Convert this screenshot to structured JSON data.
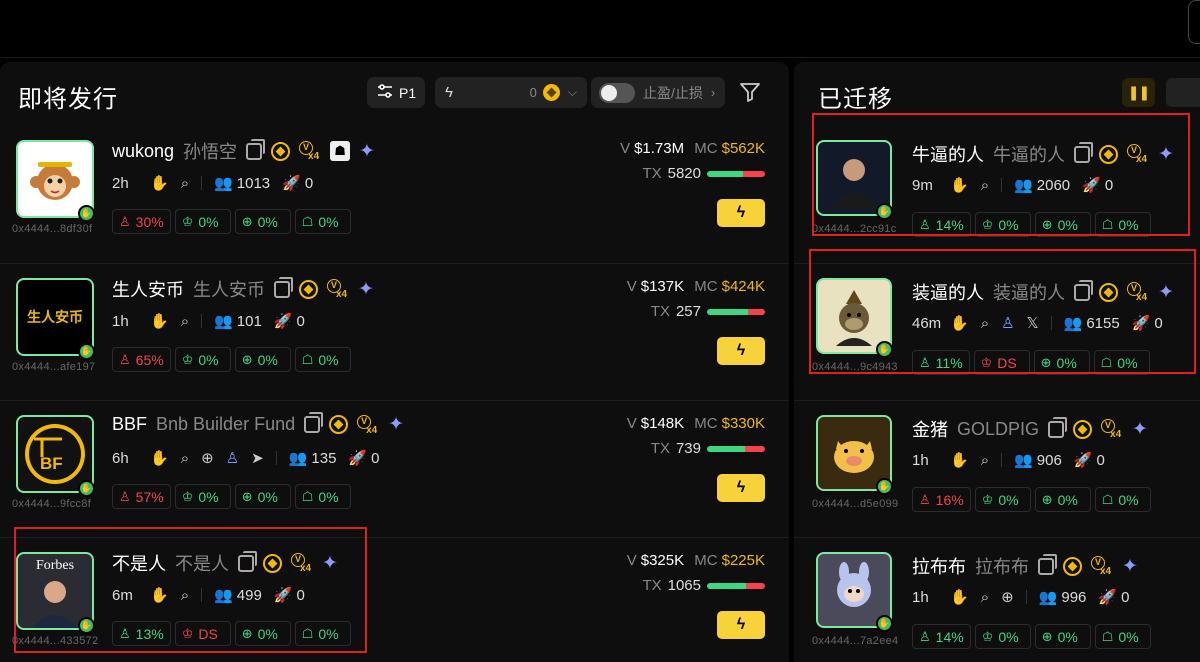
{
  "left_panel": {
    "title": "即将发行",
    "p1_label": "P1",
    "quick_buy_value": "0",
    "tp_sl_label": "止盈/止损",
    "rows": [
      {
        "symbol": "wukong",
        "name": "孙悟空",
        "age": "2h",
        "holders": "1013",
        "count": "0",
        "addr": "0x4444...8df30f",
        "stats": [
          "30%",
          "0%",
          "0%",
          "0%"
        ],
        "volume": "$1.73M",
        "mc": "$562K",
        "tx": "5820",
        "avatar_label": "🐵"
      },
      {
        "symbol": "生人安币",
        "name": "生人安币",
        "age": "1h",
        "holders": "101",
        "count": "0",
        "addr": "0x4444...afe197",
        "stats": [
          "65%",
          "0%",
          "0%",
          "0%"
        ],
        "volume": "$137K",
        "mc": "$424K",
        "tx": "257",
        "avatar_label": "生人安币"
      },
      {
        "symbol": "BBF",
        "name": "Bnb Builder Fund",
        "age": "6h",
        "holders": "135",
        "count": "0",
        "addr": "0x4444...9fcc8f",
        "stats": [
          "57%",
          "0%",
          "0%",
          "0%"
        ],
        "volume": "$148K",
        "mc": "$330K",
        "tx": "739",
        "avatar_label": "BF"
      },
      {
        "symbol": "不是人",
        "name": "不是人",
        "age": "6m",
        "holders": "499",
        "count": "0",
        "addr": "0x4444...433572",
        "stats": [
          "13%",
          "DS",
          "0%",
          "0%"
        ],
        "volume": "$325K",
        "mc": "$225K",
        "tx": "1065",
        "avatar_label": "Forbes"
      }
    ]
  },
  "right_panel": {
    "title": "已迁移",
    "rows": [
      {
        "symbol": "牛逼的人",
        "name": "牛逼的人",
        "age": "9m",
        "holders": "2060",
        "count": "0",
        "addr": "0x4444...2cc91c",
        "stats": [
          "14%",
          "0%",
          "0%",
          "0%"
        ]
      },
      {
        "symbol": "装逼的人",
        "name": "装逼的人",
        "age": "46m",
        "holders": "6155",
        "count": "0",
        "addr": "0x4444...9c4943",
        "stats": [
          "11%",
          "DS",
          "0%",
          "0%"
        ]
      },
      {
        "symbol": "金猪",
        "name": "GOLDPIG",
        "age": "1h",
        "holders": "906",
        "count": "0",
        "addr": "0x4444...d5e099",
        "stats": [
          "16%",
          "0%",
          "0%",
          "0%"
        ]
      },
      {
        "symbol": "拉布布",
        "name": "拉布布",
        "age": "1h",
        "holders": "996",
        "count": "0",
        "addr": "0x4444...7a2ee4",
        "stats": [
          "14%",
          "0%",
          "0%",
          "0%"
        ]
      }
    ]
  },
  "labels": {
    "v": "V",
    "mc": "MC",
    "tx": "TX"
  },
  "colors": {
    "accent_green": "#3fd681",
    "accent_red": "#f2434e",
    "gold": "#f0b90b",
    "bolt_yellow": "#f7d23a"
  }
}
